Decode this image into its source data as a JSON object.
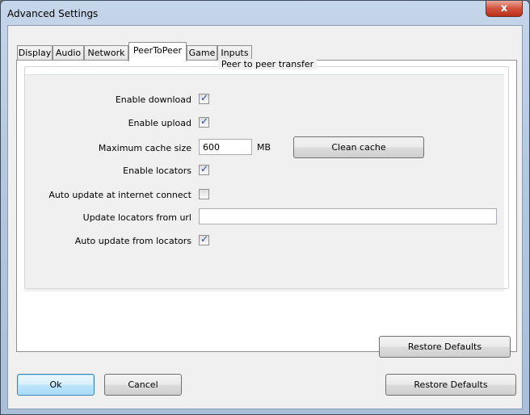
{
  "window": {
    "title": "Advanced Settings",
    "close_glyph": "x"
  },
  "tabs": [
    {
      "label": "Display"
    },
    {
      "label": "Audio"
    },
    {
      "label": "Network"
    },
    {
      "label": "PeerToPeer",
      "active": true
    },
    {
      "label": "Game"
    },
    {
      "label": "Inputs"
    }
  ],
  "group": {
    "title": "Peer to peer transfer"
  },
  "settings": {
    "enable_download": {
      "label": "Enable download",
      "checked": true
    },
    "enable_upload": {
      "label": "Enable upload",
      "checked": true
    },
    "max_cache": {
      "label": "Maximum cache size",
      "value": "600",
      "unit": "MB"
    },
    "clean_cache_button": "Clean cache",
    "enable_locators": {
      "label": "Enable locators",
      "checked": true
    },
    "auto_update_connect": {
      "label": "Auto update at internet connect",
      "checked": false
    },
    "update_locators_url": {
      "label": "Update locators from url",
      "value": ""
    },
    "auto_update_locators": {
      "label": "Auto update from locators",
      "checked": true
    }
  },
  "tab_restore_button": "Restore Defaults",
  "footer": {
    "ok": "Ok",
    "cancel": "Cancel",
    "restore": "Restore Defaults"
  },
  "colors": {
    "check": "#2b4f8a",
    "default_button_border": "#3c7fb1",
    "close_button": "#c8402a"
  }
}
